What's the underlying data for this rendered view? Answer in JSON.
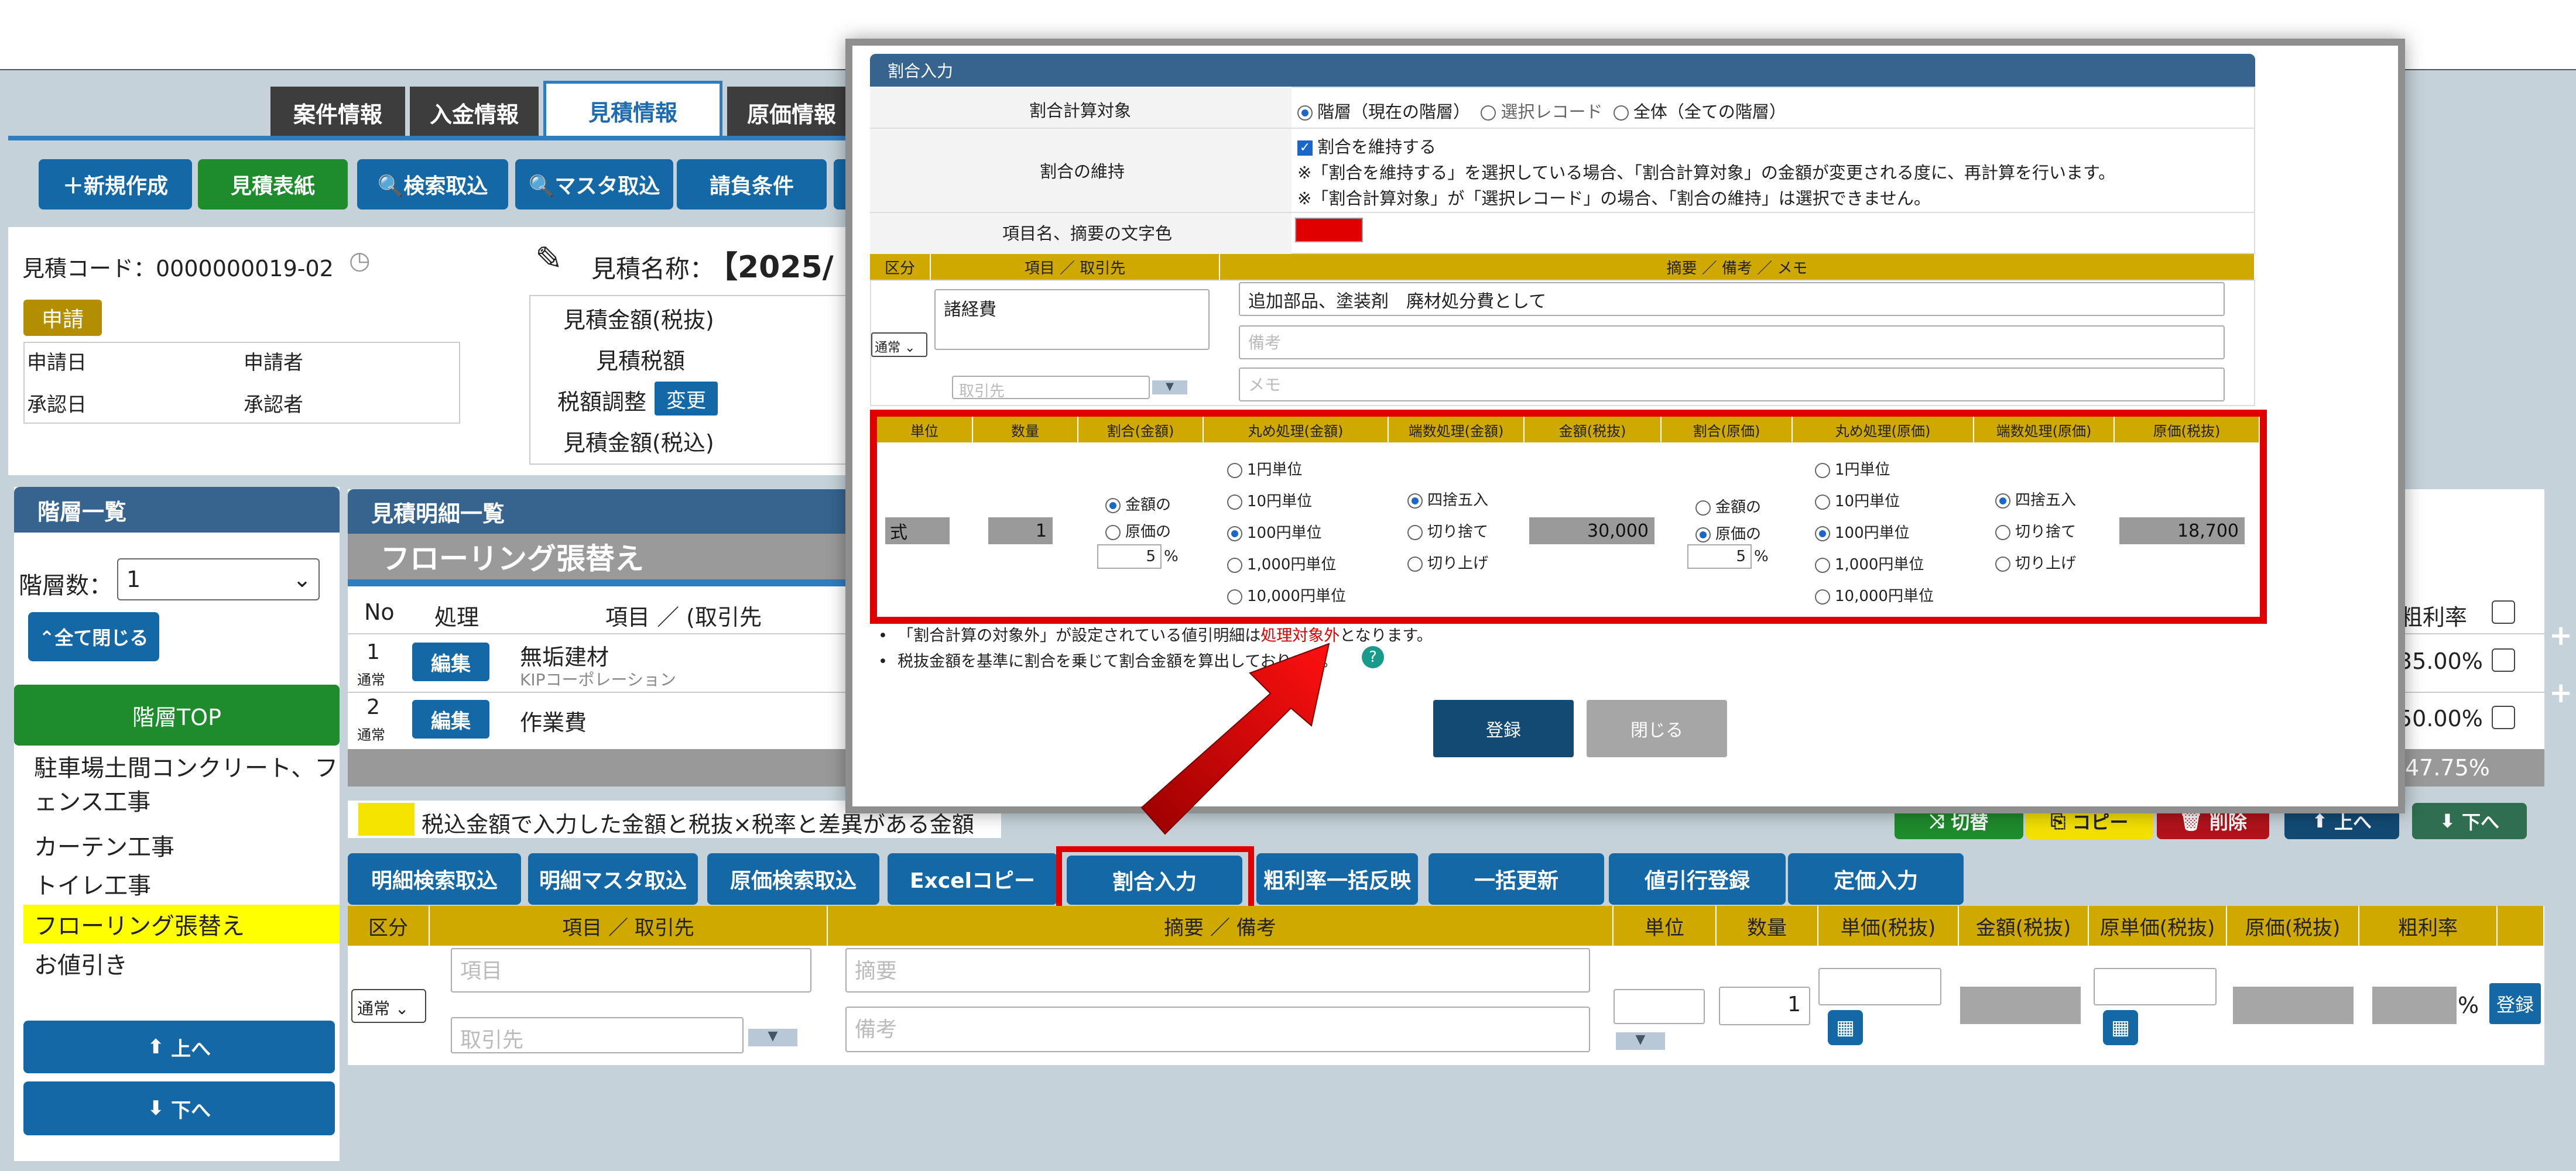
{
  "tabs": [
    "案件情報",
    "入金情報",
    "見積情報",
    "原価情報"
  ],
  "toolbar": {
    "new": "＋新規作成",
    "sheet": "見積表紙",
    "search": "🔍検索取込",
    "master": "🔍マスタ取込",
    "terms": "請負条件"
  },
  "estimate": {
    "code_label": "見積コード：0000000019-02",
    "name_label": "見積名称：",
    "name_value": "【2025/",
    "status": "申請",
    "apply_date": "申請日",
    "applicant": "申請者",
    "approve_date": "承認日",
    "approver": "承認者",
    "amount_ex": "見積金額(税抜)",
    "tax": "見積税額",
    "tax_adjust": "税額調整",
    "change": "変更",
    "amount_in": "見積金額(税込)"
  },
  "hierarchy": {
    "title": "階層一覧",
    "count_label": "階層数：",
    "count_value": "1",
    "collapse": "⌃全て閉じる",
    "top": "階層TOP",
    "items": [
      "駐車場土間コンクリート、フェンス工事",
      "カーテン工事",
      "トイレ工事",
      "フローリング張替え",
      "お値引き"
    ],
    "up": "上へ",
    "down": "下へ"
  },
  "detail": {
    "title": "見積明細一覧",
    "section": "フローリング張替え",
    "col_no": "No",
    "col_proc": "処理",
    "col_item": "項目 ／ (取引先",
    "col_rate": "粗利率",
    "rows": [
      {
        "no": "1",
        "type": "通常",
        "edit": "編集",
        "item": "無垢建材",
        "vendor": "KIPコーポレーション",
        "rate": "35.00%"
      },
      {
        "no": "2",
        "type": "通常",
        "edit": "編集",
        "item": "作業費",
        "vendor": "",
        "rate": "50.00%"
      }
    ],
    "total_rate": "47.75%",
    "legend": "税込金額で入力した金額と税抜×税率と差異がある金額",
    "switch": "切替",
    "copy": "コピー",
    "delete": "削除",
    "up": "上へ",
    "down": "下へ"
  },
  "actions": [
    "明細検索取込",
    "明細マスタ取込",
    "原価検索取込",
    "Excelコピー",
    "割合入力",
    "粗利率一括反映",
    "一括更新",
    "値引行登録",
    "定価入力"
  ],
  "entry": {
    "headers": [
      "区分",
      "項目 ／ 取引先",
      "摘要 ／ 備考",
      "単位",
      "数量",
      "単価(税抜)",
      "金額(税抜)",
      "原単価(税抜)",
      "原価(税抜)",
      "粗利率"
    ],
    "kubun": "通常",
    "item_ph": "項目",
    "vendor_ph": "取引先",
    "summary_ph": "摘要",
    "note_ph": "備考",
    "qty": "1",
    "pct": "%",
    "register": "登録"
  },
  "modal": {
    "title": "割合入力",
    "target_label": "割合計算対象",
    "target_opts": [
      "階層（現在の階層）",
      "選択レコード",
      "全体（全ての階層）"
    ],
    "keep_label": "割合の維持",
    "keep_check": "割合を維持する",
    "keep_note1": "※「割合を維持する」を選択している場合、「割合計算対象」の金額が変更される度に、再計算を行います。",
    "keep_note2": "※「割合計算対象」が「選択レコード」の場合、「割合の維持」は選択できません。",
    "color_label": "項目名、摘要の文字色",
    "color_value": "#e00000",
    "h_kubun": "区分",
    "h_item": "項目 ／ 取引先",
    "h_summary": "摘要 ／ 備考 ／ メモ",
    "item_value": "諸経費",
    "kubun_value": "通常",
    "vendor_ph": "取引先",
    "summary_value": "追加部品、塗装剤　廃材処分費として",
    "note_ph": "備考",
    "memo_ph": "メモ",
    "g_headers": [
      "単位",
      "数量",
      "割合(金額)",
      "丸め処理(金額)",
      "端数処理(金額)",
      "金額(税抜)",
      "割合(原価)",
      "丸め処理(原価)",
      "端数処理(原価)",
      "原価(税抜)"
    ],
    "unit": "式",
    "qty": "1",
    "ratio_opts_amt": [
      "金額の",
      "原価の"
    ],
    "ratio_amt": "5",
    "round_opts": [
      "1円単位",
      "10円単位",
      "100円単位",
      "1,000円単位",
      "10,000円単位"
    ],
    "frac_opts": [
      "四捨五入",
      "切り捨て",
      "切り上げ"
    ],
    "amount": "30,000",
    "ratio_cost": "5",
    "cost": "18,700",
    "pct": "%",
    "note1_a": "「割合計算の対象外」が設定されている値引明細は",
    "note1_red": "処理対象外",
    "note1_b": "となります。",
    "note2": "税抜金額を基準に割合を乗じて割合金額を算出しております。",
    "ok": "登録",
    "close": "閉じる"
  },
  "colors": {
    "accent": "#1568a6",
    "green": "#1e8b2c",
    "highlight": "#e00000",
    "yellow": "#cfa800"
  }
}
